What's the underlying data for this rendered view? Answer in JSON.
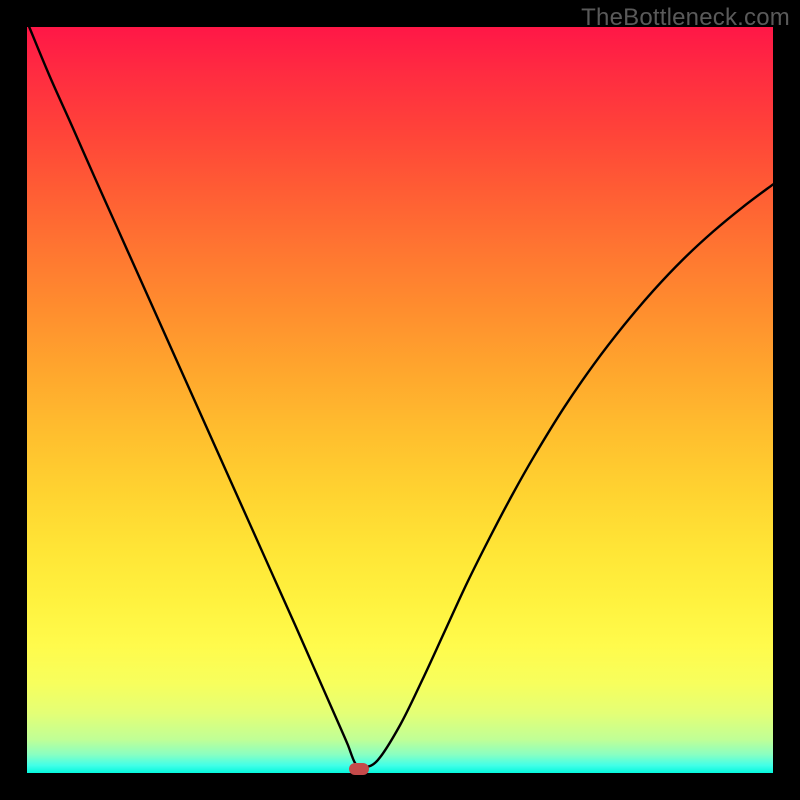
{
  "watermark": "TheBottleneck.com",
  "chart_data": {
    "type": "line",
    "title": "",
    "xlabel": "",
    "ylabel": "",
    "xlim": [
      0,
      100
    ],
    "ylim": [
      0,
      100
    ],
    "grid": false,
    "legend": false,
    "series": [
      {
        "name": "curve",
        "x": [
          0.3,
          3,
          6,
          9,
          12,
          15,
          18,
          21,
          24,
          27,
          30,
          33,
          36,
          37.5,
          39,
          40.5,
          42,
          43,
          44,
          45,
          47,
          50,
          53,
          56,
          59,
          62,
          65,
          68,
          72,
          76,
          80,
          84,
          88,
          92,
          96,
          100
        ],
        "y": [
          100,
          93.5,
          86.8,
          80.0,
          73.3,
          66.6,
          59.9,
          53.2,
          46.5,
          39.8,
          33.1,
          26.4,
          19.7,
          16.3,
          12.9,
          9.5,
          6.1,
          3.8,
          1.3,
          0.8,
          1.7,
          6.4,
          12.5,
          19.0,
          25.5,
          31.5,
          37.2,
          42.5,
          49.0,
          54.8,
          60.0,
          64.7,
          68.9,
          72.6,
          75.9,
          78.9
        ]
      }
    ],
    "marker": {
      "x": 44.5,
      "y": 0.5,
      "color": "#c54a4a"
    },
    "background_gradient": {
      "direction": "vertical",
      "stops": [
        {
          "pos": 0.0,
          "color": "#ff1747"
        },
        {
          "pos": 0.3,
          "color": "#ff7631"
        },
        {
          "pos": 0.6,
          "color": "#ffd230"
        },
        {
          "pos": 0.85,
          "color": "#fffb4c"
        },
        {
          "pos": 1.0,
          "color": "#05f8dd"
        }
      ]
    }
  }
}
